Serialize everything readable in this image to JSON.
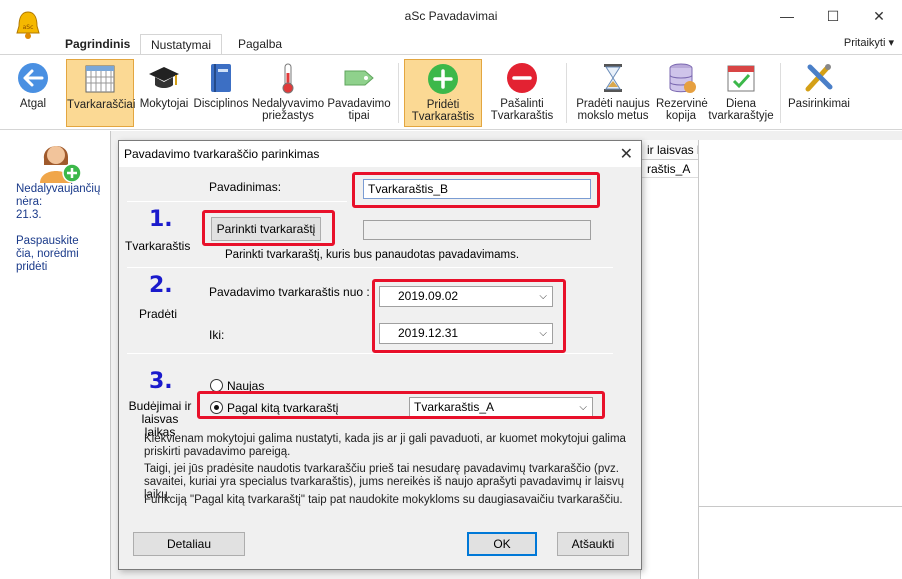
{
  "window": {
    "title": "aSc Pavadavimai",
    "minimize": "—",
    "maximize": "☐",
    "close": "✕"
  },
  "ribbon_tabs": [
    {
      "label": "Pagrindinis"
    },
    {
      "label": "Nustatymai"
    },
    {
      "label": "Pagalba"
    }
  ],
  "customize_label": "Pritaikyti ▾",
  "ribbon": {
    "buttons": [
      {
        "label": "Atgal",
        "icon": "back-arrow-icon"
      },
      {
        "label": "Tvarkaraščiai",
        "icon": "timetable-grid-icon"
      },
      {
        "label": "Mokytojai",
        "icon": "graduation-cap-icon"
      },
      {
        "label": "Disciplinos",
        "icon": "book-icon"
      },
      {
        "label": "Nedalyvavimo priežastys",
        "icon": "thermometer-icon"
      },
      {
        "label": "Pavadavimo tipai",
        "icon": "tag-icon"
      },
      {
        "label": "Pridėti Tvarkaraštis",
        "icon": "add-circle-icon"
      },
      {
        "label": "Pašalinti Tvarkaraštis",
        "icon": "remove-circle-icon"
      },
      {
        "label": "Pradėti naujus mokslo metus",
        "icon": "hourglass-icon"
      },
      {
        "label": "Rezervinė kopija",
        "icon": "database-icon"
      },
      {
        "label": "Diena tvarkaraštyje",
        "icon": "calendar-check-icon"
      },
      {
        "label": "Pasirinkimai",
        "icon": "tools-icon"
      }
    ]
  },
  "left_pane": {
    "absent_label": "Nedalyvaujančių nėra:",
    "absent_value": "21.3.",
    "hint": "Paspauskite čia, norėdmi pridėti"
  },
  "grid": {
    "header": "ir laisvas la",
    "cell": "raštis_A"
  },
  "dialog": {
    "title": "Pavadavimo tvarkaraščio parinkimas",
    "close": "✕",
    "name_label": "Pavadinimas:",
    "name_value": "Tvarkaraštis_B",
    "step1": {
      "number": "1.",
      "section": "Tvarkaraštis",
      "button": "Parinkti tvarkaraštį",
      "hint": "Parinkti tvarkaraštį, kuris bus panaudotas pavadavimams."
    },
    "step2": {
      "number": "2.",
      "section": "Pradėti",
      "from_label": "Pavadavimo tvarkaraštis nuo :",
      "from_value": "2019.09.02",
      "to_label": "Iki:",
      "to_value": "2019.12.31"
    },
    "step3": {
      "number": "3.",
      "section": "Budėjimai ir laisvas laikas",
      "option_new": "Naujas",
      "option_other": "Pagal kitą tvarkaraštį",
      "other_value": "Tvarkaraštis_A"
    },
    "paragraphs": [
      "Kiekvienam mokytojui galima nustatyti, kada jis ar ji gali pavaduoti, ar kuomet mokytojui galima priskirti pavadavimo pareigą.",
      "Taigi, jei jūs pradėsite naudotis tvarkaraščiu prieš tai nesudarę pavadavimų tvarkaraščio (pvz. savaitei, kuriai yra specialus tvarkaraštis), jums nereikės iš naujo aprašyti pavadavimų ir laisvų laikų.",
      "Funkciją \"Pagal kitą tvarkaraštį\" taip pat naudokite mokykloms su daugiasavaičiu tvarkaraščiu."
    ],
    "buttons": {
      "details": "Detaliau",
      "ok": "OK",
      "cancel": "Atšaukti"
    }
  },
  "colors": {
    "accent_red": "#e8102a",
    "step_number_blue": "#1a1acc",
    "selected_button_bg": "#fbd994"
  }
}
